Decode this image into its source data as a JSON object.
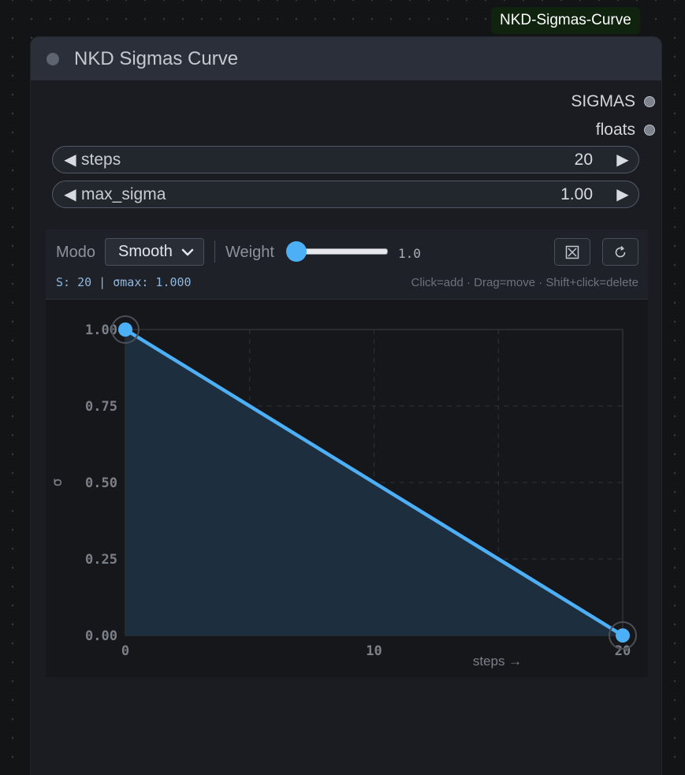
{
  "badge": {
    "label": "NKD-Sigmas-Curve"
  },
  "node": {
    "title": "NKD Sigmas Curve",
    "outputs": [
      {
        "label": "SIGMAS"
      },
      {
        "label": "floats"
      }
    ],
    "widgets": {
      "steps": {
        "label": "steps",
        "value": "20"
      },
      "max_sigma": {
        "label": "max_sigma",
        "value": "1.00"
      }
    }
  },
  "toolbar": {
    "modo_label": "Modo",
    "modo_value": "Smooth",
    "weight_label": "Weight",
    "weight_value": "1.0",
    "weight_fraction": 0.0,
    "clear_icon": "clear-box-icon",
    "reset_icon": "reset-icon",
    "status": "S: 20 | σmax: 1.000",
    "hint": "Click=add · Drag=move · Shift+click=delete"
  },
  "colors": {
    "accent": "#4db0f7",
    "fill": "#1d2e3f",
    "grid": "#2e3238"
  },
  "chart_data": {
    "type": "line",
    "x": [
      0,
      20
    ],
    "y": [
      1.0,
      0.0
    ],
    "xlim": [
      0,
      20
    ],
    "ylim": [
      0,
      1
    ],
    "x_ticks": [
      "0",
      "10",
      "20"
    ],
    "y_ticks": [
      "0.00",
      "0.25",
      "0.50",
      "0.75",
      "1.00"
    ],
    "xlabel": "steps →",
    "ylabel": "σ",
    "grid": true,
    "control_points": [
      [
        0,
        1.0
      ],
      [
        20,
        0.0
      ]
    ]
  }
}
